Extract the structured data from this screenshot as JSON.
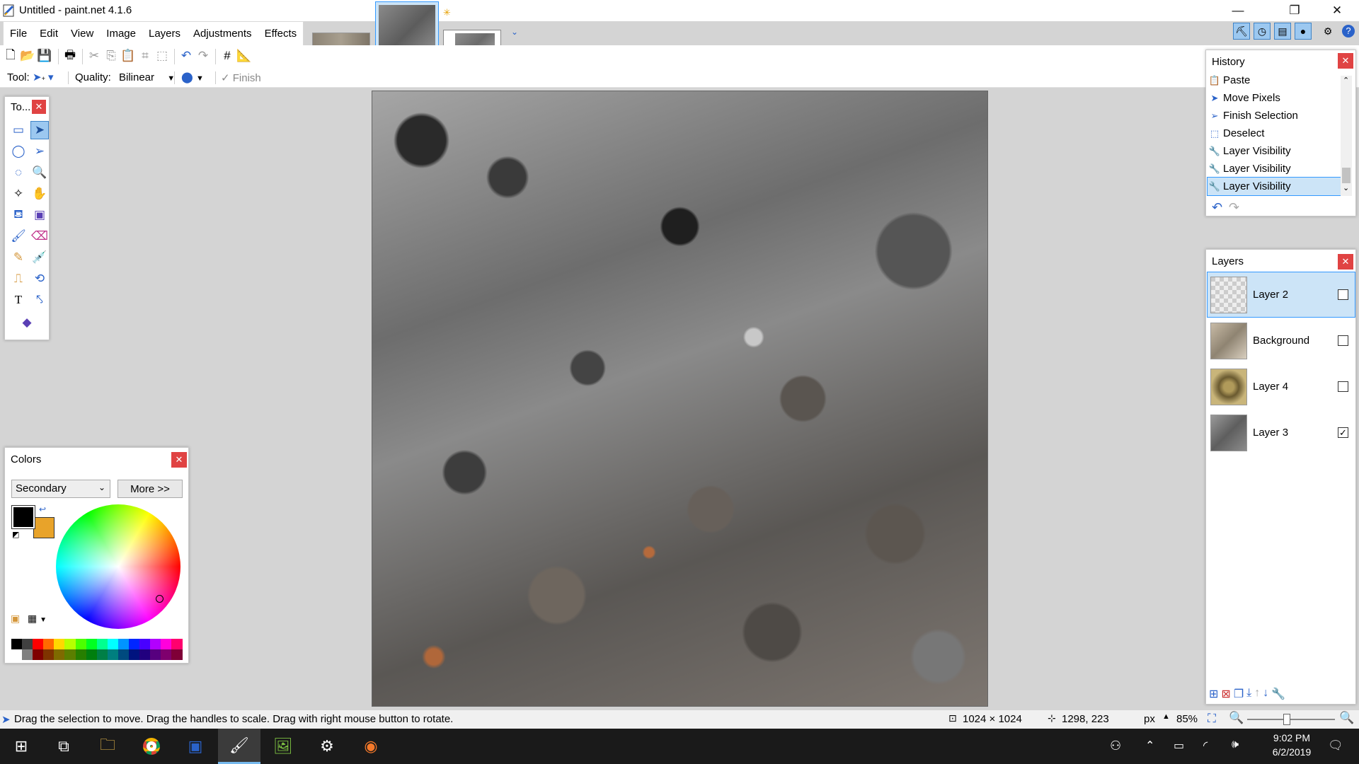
{
  "window": {
    "title": "Untitled - paint.net 4.1.6",
    "controls": {
      "minimize": "—",
      "restore": "❐",
      "close": "✕"
    }
  },
  "menu": [
    "File",
    "Edit",
    "View",
    "Image",
    "Layers",
    "Adjustments",
    "Effects"
  ],
  "toolbar_options": {
    "tool_label": "Tool:",
    "quality_label": "Quality:",
    "quality_value": "Bilinear",
    "finish_label": "Finish"
  },
  "tools_panel": {
    "title": "To..."
  },
  "colors_panel": {
    "title": "Colors",
    "selector_value": "Secondary",
    "more_button": "More >>",
    "primary_color": "#000000",
    "secondary_color": "#e8a32a",
    "palette": [
      "#000000",
      "#404040",
      "#ff0000",
      "#ff6a00",
      "#ffd800",
      "#b6ff00",
      "#4cff00",
      "#00ff21",
      "#00ff90",
      "#00ffff",
      "#0094ff",
      "#0026ff",
      "#4800ff",
      "#b200ff",
      "#ff00dc",
      "#ff006e",
      "#ffffff",
      "#808080",
      "#7f0000",
      "#7f3300",
      "#7f6a00",
      "#5b7f00",
      "#267f00",
      "#007f0e",
      "#007f46",
      "#007f7f",
      "#004a7f",
      "#00137f",
      "#21007f",
      "#57007f",
      "#7f006e",
      "#7f0037"
    ]
  },
  "history_panel": {
    "title": "History",
    "items": [
      {
        "label": "Paste",
        "icon": "paste-icon"
      },
      {
        "label": "Move Pixels",
        "icon": "move-pixels-icon"
      },
      {
        "label": "Finish Selection",
        "icon": "move-selection-icon"
      },
      {
        "label": "Deselect",
        "icon": "deselect-icon"
      },
      {
        "label": "Layer Visibility",
        "icon": "wrench-icon"
      },
      {
        "label": "Layer Visibility",
        "icon": "wrench-icon"
      },
      {
        "label": "Layer Visibility",
        "icon": "wrench-icon"
      }
    ],
    "selected_index": 6
  },
  "layers_panel": {
    "title": "Layers",
    "layers": [
      {
        "name": "Layer 2",
        "visible": false,
        "selected": true
      },
      {
        "name": "Background",
        "visible": false,
        "selected": false
      },
      {
        "name": "Layer 4",
        "visible": false,
        "selected": false
      },
      {
        "name": "Layer 3",
        "visible": true,
        "selected": false
      }
    ]
  },
  "status": {
    "hint": "Drag the selection to move. Drag the handles to scale. Drag with right mouse button to rotate.",
    "image_size": "1024 × 1024",
    "cursor_pos": "1298, 223",
    "units": "px",
    "zoom": "85%"
  },
  "taskbar": {
    "time": "9:02 PM",
    "date": "6/2/2019"
  },
  "colors": {
    "accent": "#3399ff",
    "selected_bg": "#cce4f7",
    "close_red": "#e04343"
  }
}
